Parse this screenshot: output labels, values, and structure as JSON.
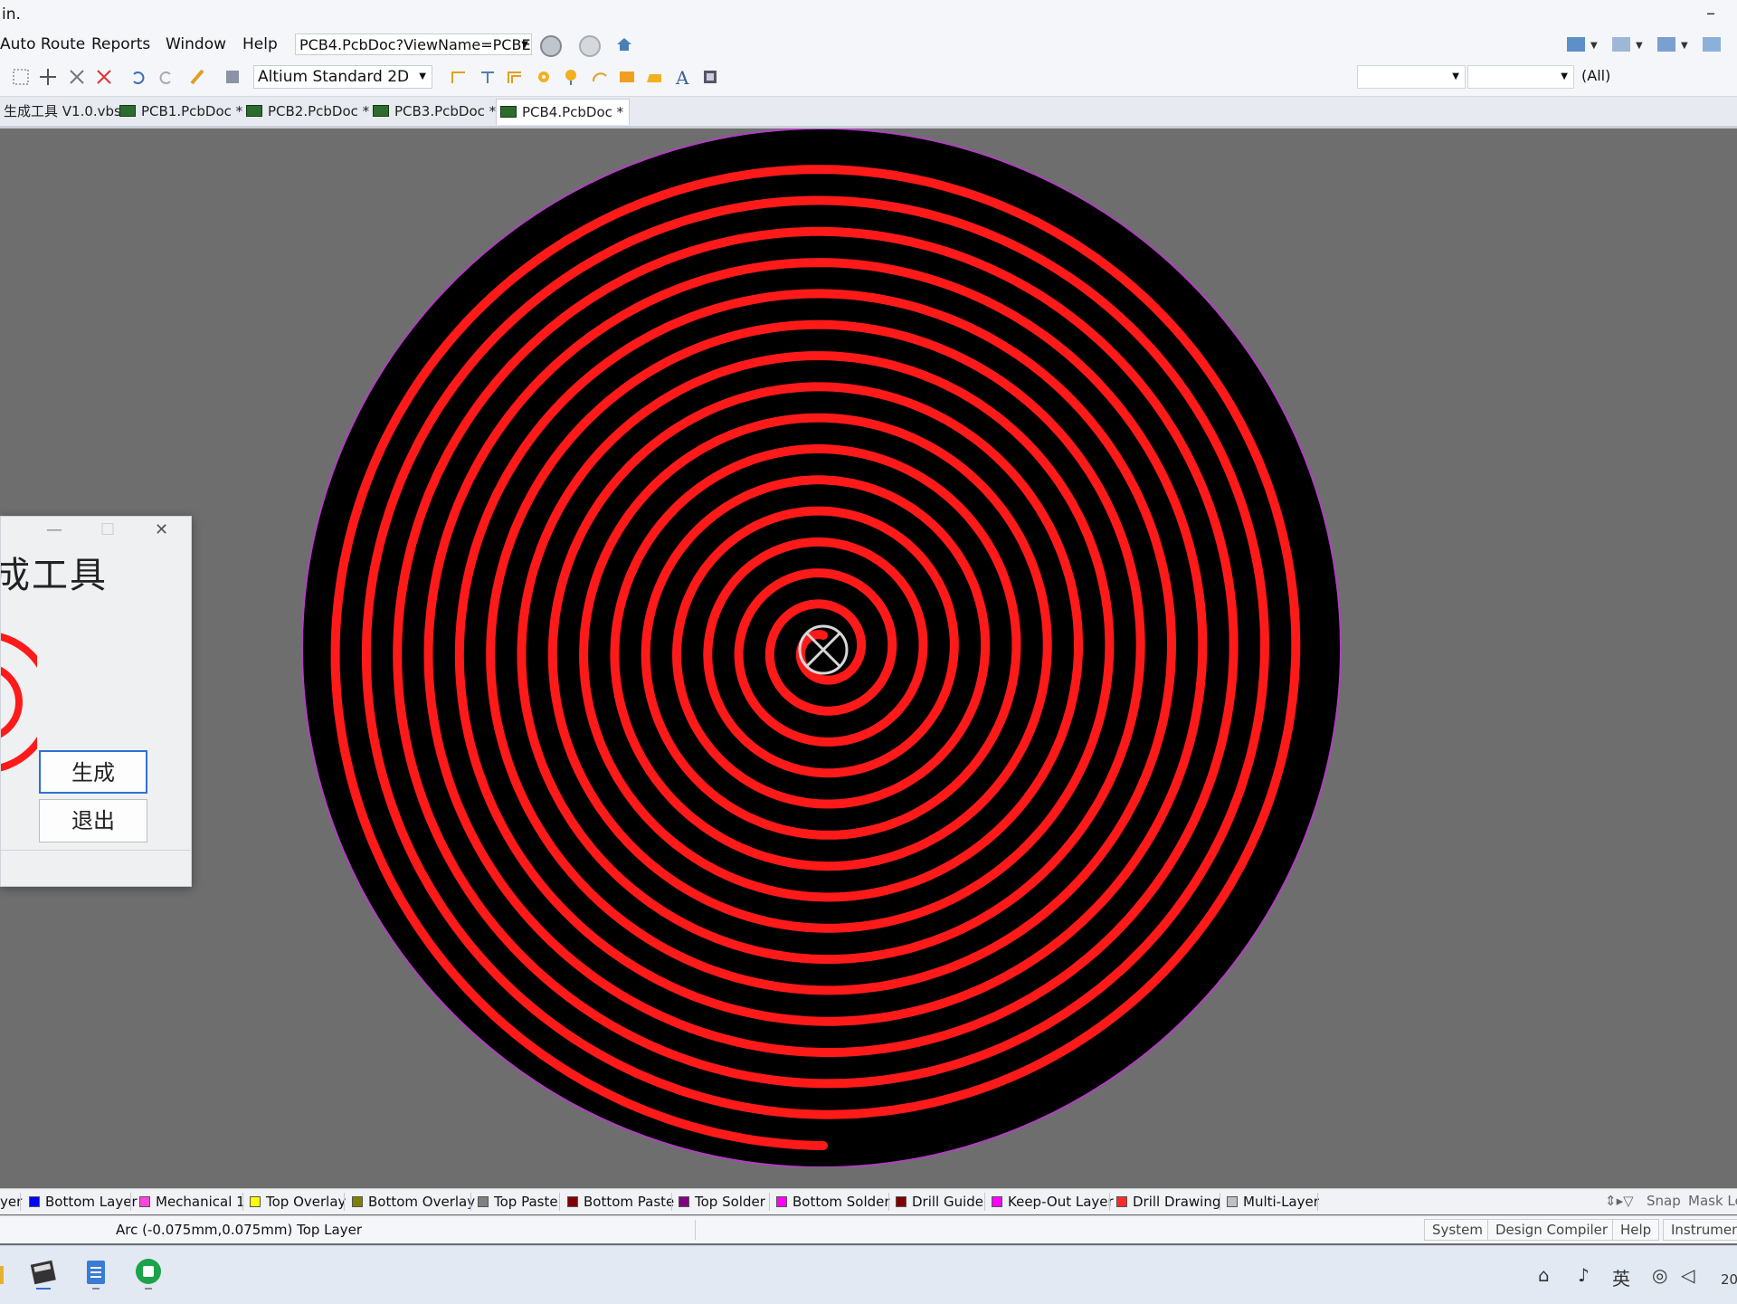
{
  "window": {
    "title": "in.",
    "minimize": "–"
  },
  "menu": {
    "items": [
      {
        "label": "Auto Route",
        "accel": "A",
        "rest": "uto Route"
      },
      {
        "label": "Reports",
        "accel": "R",
        "rest": "eports"
      },
      {
        "label": "Window",
        "accel": "W",
        "rest": "indow"
      },
      {
        "label": "Help",
        "accel": "H",
        "rest": "elp"
      }
    ],
    "path": "PCB4.PcbDoc?ViewName=PCBE"
  },
  "toolbar": {
    "view_mode": "Altium Standard 2D",
    "filter_all": "(All)"
  },
  "tabs": [
    {
      "label": "生成工具 V1.0.vbs",
      "active": false
    },
    {
      "label": "PCB1.PcbDoc *",
      "active": false
    },
    {
      "label": "PCB2.PcbDoc *",
      "active": false
    },
    {
      "label": "PCB3.PcbDoc *",
      "active": false
    },
    {
      "label": "PCB4.PcbDoc *",
      "active": true
    }
  ],
  "dialog": {
    "title": "成工具",
    "generate": "生成",
    "exit": "退出"
  },
  "layers": [
    {
      "label": "yer",
      "color": "#ff0000"
    },
    {
      "label": "Bottom Layer",
      "color": "#0000ff"
    },
    {
      "label": "Mechanical 1",
      "color": "#ff44dd"
    },
    {
      "label": "Top Overlay",
      "color": "#ffff00"
    },
    {
      "label": "Bottom Overlay",
      "color": "#808000"
    },
    {
      "label": "Top Paste",
      "color": "#808080"
    },
    {
      "label": "Bottom Paste",
      "color": "#800000"
    },
    {
      "label": "Top Solder",
      "color": "#800080"
    },
    {
      "label": "Bottom Solder",
      "color": "#ff00ff"
    },
    {
      "label": "Drill Guide",
      "color": "#800000"
    },
    {
      "label": "Keep-Out Layer",
      "color": "#ff00ff"
    },
    {
      "label": "Drill Drawing",
      "color": "#ff2a2a"
    },
    {
      "label": "Multi-Layer",
      "color": "#c0c0c0"
    }
  ],
  "layerbar_right": {
    "snap": "Snap",
    "mask": "Mask Le"
  },
  "status": {
    "text": "Arc (-0.075mm,0.075mm)  Top Layer",
    "panels": [
      "System",
      "Design Compiler",
      "Help",
      "Instrument"
    ]
  },
  "tray": {
    "ime": "英",
    "clock": "20"
  },
  "colors": {
    "board": "#000000",
    "trace": "#ff1a1a",
    "outline": "#b040c0",
    "canvas": "#6e6e6e"
  }
}
